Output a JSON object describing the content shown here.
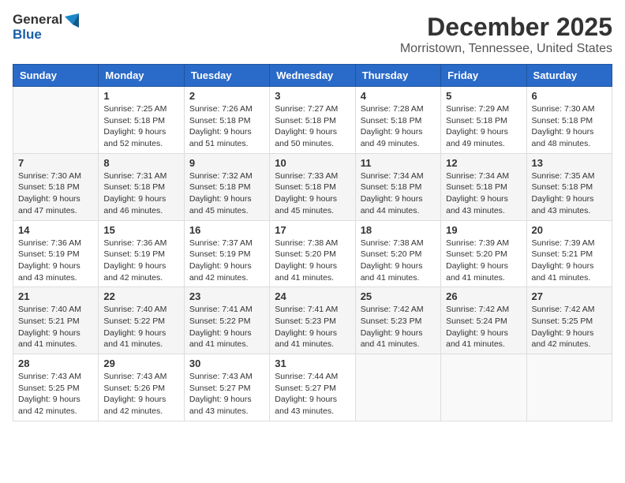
{
  "logo": {
    "general": "General",
    "blue": "Blue"
  },
  "header": {
    "month": "December 2025",
    "location": "Morristown, Tennessee, United States"
  },
  "weekdays": [
    "Sunday",
    "Monday",
    "Tuesday",
    "Wednesday",
    "Thursday",
    "Friday",
    "Saturday"
  ],
  "weeks": [
    [
      {
        "day": "",
        "sunrise": "",
        "sunset": "",
        "daylight": ""
      },
      {
        "day": "1",
        "sunrise": "Sunrise: 7:25 AM",
        "sunset": "Sunset: 5:18 PM",
        "daylight": "Daylight: 9 hours and 52 minutes."
      },
      {
        "day": "2",
        "sunrise": "Sunrise: 7:26 AM",
        "sunset": "Sunset: 5:18 PM",
        "daylight": "Daylight: 9 hours and 51 minutes."
      },
      {
        "day": "3",
        "sunrise": "Sunrise: 7:27 AM",
        "sunset": "Sunset: 5:18 PM",
        "daylight": "Daylight: 9 hours and 50 minutes."
      },
      {
        "day": "4",
        "sunrise": "Sunrise: 7:28 AM",
        "sunset": "Sunset: 5:18 PM",
        "daylight": "Daylight: 9 hours and 49 minutes."
      },
      {
        "day": "5",
        "sunrise": "Sunrise: 7:29 AM",
        "sunset": "Sunset: 5:18 PM",
        "daylight": "Daylight: 9 hours and 49 minutes."
      },
      {
        "day": "6",
        "sunrise": "Sunrise: 7:30 AM",
        "sunset": "Sunset: 5:18 PM",
        "daylight": "Daylight: 9 hours and 48 minutes."
      }
    ],
    [
      {
        "day": "7",
        "sunrise": "Sunrise: 7:30 AM",
        "sunset": "Sunset: 5:18 PM",
        "daylight": "Daylight: 9 hours and 47 minutes."
      },
      {
        "day": "8",
        "sunrise": "Sunrise: 7:31 AM",
        "sunset": "Sunset: 5:18 PM",
        "daylight": "Daylight: 9 hours and 46 minutes."
      },
      {
        "day": "9",
        "sunrise": "Sunrise: 7:32 AM",
        "sunset": "Sunset: 5:18 PM",
        "daylight": "Daylight: 9 hours and 45 minutes."
      },
      {
        "day": "10",
        "sunrise": "Sunrise: 7:33 AM",
        "sunset": "Sunset: 5:18 PM",
        "daylight": "Daylight: 9 hours and 45 minutes."
      },
      {
        "day": "11",
        "sunrise": "Sunrise: 7:34 AM",
        "sunset": "Sunset: 5:18 PM",
        "daylight": "Daylight: 9 hours and 44 minutes."
      },
      {
        "day": "12",
        "sunrise": "Sunrise: 7:34 AM",
        "sunset": "Sunset: 5:18 PM",
        "daylight": "Daylight: 9 hours and 43 minutes."
      },
      {
        "day": "13",
        "sunrise": "Sunrise: 7:35 AM",
        "sunset": "Sunset: 5:18 PM",
        "daylight": "Daylight: 9 hours and 43 minutes."
      }
    ],
    [
      {
        "day": "14",
        "sunrise": "Sunrise: 7:36 AM",
        "sunset": "Sunset: 5:19 PM",
        "daylight": "Daylight: 9 hours and 43 minutes."
      },
      {
        "day": "15",
        "sunrise": "Sunrise: 7:36 AM",
        "sunset": "Sunset: 5:19 PM",
        "daylight": "Daylight: 9 hours and 42 minutes."
      },
      {
        "day": "16",
        "sunrise": "Sunrise: 7:37 AM",
        "sunset": "Sunset: 5:19 PM",
        "daylight": "Daylight: 9 hours and 42 minutes."
      },
      {
        "day": "17",
        "sunrise": "Sunrise: 7:38 AM",
        "sunset": "Sunset: 5:20 PM",
        "daylight": "Daylight: 9 hours and 41 minutes."
      },
      {
        "day": "18",
        "sunrise": "Sunrise: 7:38 AM",
        "sunset": "Sunset: 5:20 PM",
        "daylight": "Daylight: 9 hours and 41 minutes."
      },
      {
        "day": "19",
        "sunrise": "Sunrise: 7:39 AM",
        "sunset": "Sunset: 5:20 PM",
        "daylight": "Daylight: 9 hours and 41 minutes."
      },
      {
        "day": "20",
        "sunrise": "Sunrise: 7:39 AM",
        "sunset": "Sunset: 5:21 PM",
        "daylight": "Daylight: 9 hours and 41 minutes."
      }
    ],
    [
      {
        "day": "21",
        "sunrise": "Sunrise: 7:40 AM",
        "sunset": "Sunset: 5:21 PM",
        "daylight": "Daylight: 9 hours and 41 minutes."
      },
      {
        "day": "22",
        "sunrise": "Sunrise: 7:40 AM",
        "sunset": "Sunset: 5:22 PM",
        "daylight": "Daylight: 9 hours and 41 minutes."
      },
      {
        "day": "23",
        "sunrise": "Sunrise: 7:41 AM",
        "sunset": "Sunset: 5:22 PM",
        "daylight": "Daylight: 9 hours and 41 minutes."
      },
      {
        "day": "24",
        "sunrise": "Sunrise: 7:41 AM",
        "sunset": "Sunset: 5:23 PM",
        "daylight": "Daylight: 9 hours and 41 minutes."
      },
      {
        "day": "25",
        "sunrise": "Sunrise: 7:42 AM",
        "sunset": "Sunset: 5:23 PM",
        "daylight": "Daylight: 9 hours and 41 minutes."
      },
      {
        "day": "26",
        "sunrise": "Sunrise: 7:42 AM",
        "sunset": "Sunset: 5:24 PM",
        "daylight": "Daylight: 9 hours and 41 minutes."
      },
      {
        "day": "27",
        "sunrise": "Sunrise: 7:42 AM",
        "sunset": "Sunset: 5:25 PM",
        "daylight": "Daylight: 9 hours and 42 minutes."
      }
    ],
    [
      {
        "day": "28",
        "sunrise": "Sunrise: 7:43 AM",
        "sunset": "Sunset: 5:25 PM",
        "daylight": "Daylight: 9 hours and 42 minutes."
      },
      {
        "day": "29",
        "sunrise": "Sunrise: 7:43 AM",
        "sunset": "Sunset: 5:26 PM",
        "daylight": "Daylight: 9 hours and 42 minutes."
      },
      {
        "day": "30",
        "sunrise": "Sunrise: 7:43 AM",
        "sunset": "Sunset: 5:27 PM",
        "daylight": "Daylight: 9 hours and 43 minutes."
      },
      {
        "day": "31",
        "sunrise": "Sunrise: 7:44 AM",
        "sunset": "Sunset: 5:27 PM",
        "daylight": "Daylight: 9 hours and 43 minutes."
      },
      {
        "day": "",
        "sunrise": "",
        "sunset": "",
        "daylight": ""
      },
      {
        "day": "",
        "sunrise": "",
        "sunset": "",
        "daylight": ""
      },
      {
        "day": "",
        "sunrise": "",
        "sunset": "",
        "daylight": ""
      }
    ]
  ]
}
